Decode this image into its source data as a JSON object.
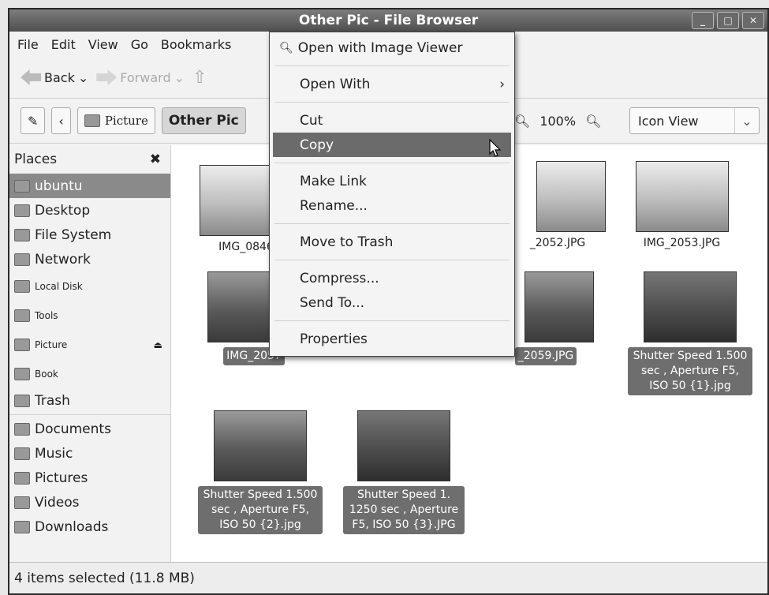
{
  "window": {
    "title": "Other Pic - File Browser",
    "buttons": [
      "_",
      "□",
      "✕"
    ]
  },
  "menubar": {
    "items": [
      "File",
      "Edit",
      "View",
      "Go",
      "Bookmarks"
    ]
  },
  "toolbar": {
    "back_label": "Back",
    "forward_label": "Forward"
  },
  "location": {
    "crumbs": [
      "Picture",
      "Other Pic"
    ],
    "zoom": "100%",
    "view_mode": "Icon View"
  },
  "sidebar": {
    "header": "Places",
    "items": [
      {
        "label": "ubuntu",
        "selected": true
      },
      {
        "label": "Desktop"
      },
      {
        "label": "File System"
      },
      {
        "label": "Network"
      },
      {
        "label": "Local Disk"
      },
      {
        "label": "Tools"
      },
      {
        "label": "Picture"
      },
      {
        "label": "Book"
      },
      {
        "label": "Trash"
      },
      {
        "label": "Documents"
      },
      {
        "label": "Music"
      },
      {
        "label": "Pictures"
      },
      {
        "label": "Videos"
      },
      {
        "label": "Downloads"
      }
    ]
  },
  "files": [
    {
      "name": "IMG_0846",
      "selected": false
    },
    {
      "name": "_2052.JPG",
      "selected": false
    },
    {
      "name": "IMG_2053.JPG",
      "selected": false
    },
    {
      "name": "IMG_2057",
      "selected": true
    },
    {
      "name": "_2059.JPG",
      "selected": true
    },
    {
      "name": "Shutter Speed 1.500 sec , Aperture F5, ISO 50 {1}.jpg",
      "selected": true
    },
    {
      "name": "Shutter Speed 1.500 sec , Aperture F5, ISO 50 {2}.jpg",
      "selected": true
    },
    {
      "name": "Shutter Speed 1. 1250 sec , Aperture F5, ISO 50 {3}.JPG",
      "selected": true
    }
  ],
  "context_menu": {
    "items": [
      {
        "label": "Open with Image Viewer"
      },
      {
        "label": "Open With",
        "submenu": true
      },
      {
        "label": "Cut"
      },
      {
        "label": "Copy",
        "highlighted": true
      },
      {
        "label": "Make Link"
      },
      {
        "label": "Rename..."
      },
      {
        "label": "Move to Trash"
      },
      {
        "label": "Compress..."
      },
      {
        "label": "Send To..."
      },
      {
        "label": "Properties"
      }
    ]
  },
  "status": {
    "text": "4 items selected (11.8 MB)"
  }
}
